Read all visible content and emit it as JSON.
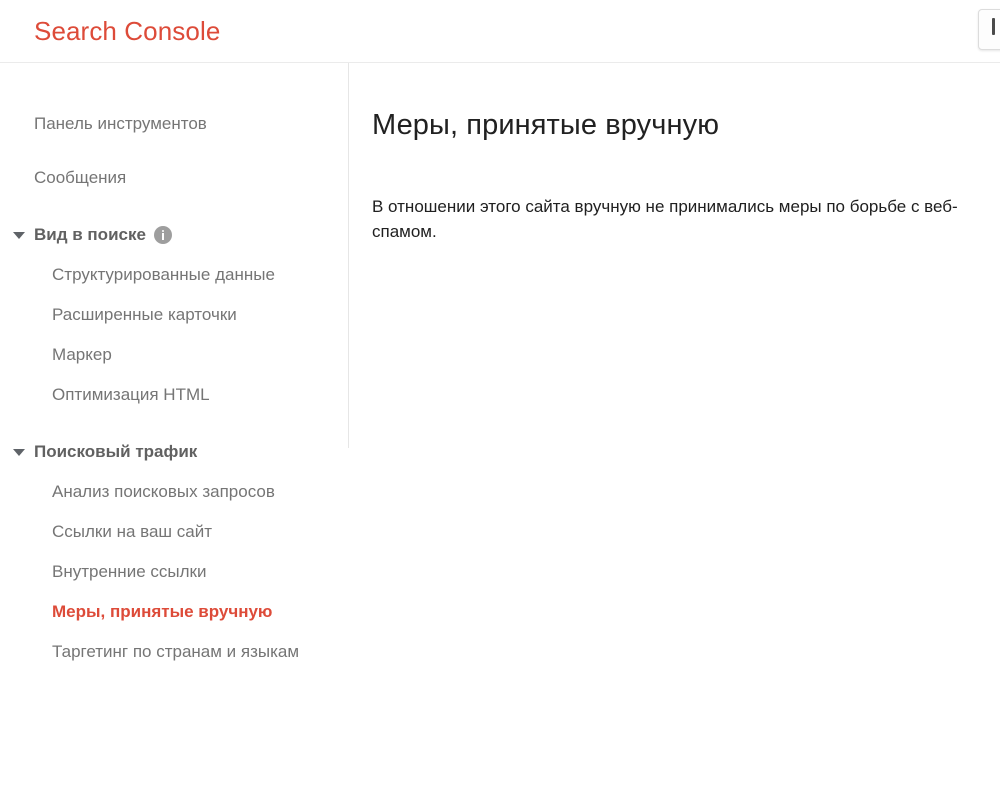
{
  "header": {
    "brand_title": "Search Console",
    "accent_color": "#dd4b39",
    "right_control_name": "cut-off-control"
  },
  "sidebar": {
    "items": [
      {
        "label": "Панель инструментов",
        "type": "top",
        "name": "sidebar-item-dashboard",
        "selected": false
      },
      {
        "label": "Сообщения",
        "type": "top",
        "name": "sidebar-item-messages",
        "selected": false
      },
      {
        "label": "Вид в поиске",
        "type": "section",
        "name": "sidebar-section-search-appearance",
        "expanded": true,
        "has_info_icon": true
      },
      {
        "label": "Структурированные данные",
        "type": "sub",
        "name": "sidebar-item-structured-data",
        "selected": false
      },
      {
        "label": "Расширенные карточки",
        "type": "sub",
        "name": "sidebar-item-rich-cards",
        "selected": false
      },
      {
        "label": "Маркер",
        "type": "sub",
        "name": "sidebar-item-data-highlighter",
        "selected": false
      },
      {
        "label": "Оптимизация HTML",
        "type": "sub",
        "name": "sidebar-item-html-improvements",
        "selected": false
      },
      {
        "label": "Поисковый трафик",
        "type": "section",
        "name": "sidebar-section-search-traffic",
        "expanded": true,
        "has_info_icon": false
      },
      {
        "label": "Анализ поисковых запросов",
        "type": "sub",
        "name": "sidebar-item-search-analytics",
        "selected": false
      },
      {
        "label": "Ссылки на ваш сайт",
        "type": "sub",
        "name": "sidebar-item-links-to-your-site",
        "selected": false
      },
      {
        "label": "Внутренние ссылки",
        "type": "sub",
        "name": "sidebar-item-internal-links",
        "selected": false
      },
      {
        "label": "Меры, принятые вручную",
        "type": "sub",
        "name": "sidebar-item-manual-actions",
        "selected": true
      },
      {
        "label": "Таргетинг по странам и языкам",
        "type": "sub",
        "name": "sidebar-item-international-targeting",
        "selected": false
      }
    ],
    "selected_color": "#dd4b39"
  },
  "main": {
    "title": "Меры, принятые вручную",
    "paragraph": "В отношении этого сайта вручную не принимались меры по борьбе с веб-спамом."
  }
}
